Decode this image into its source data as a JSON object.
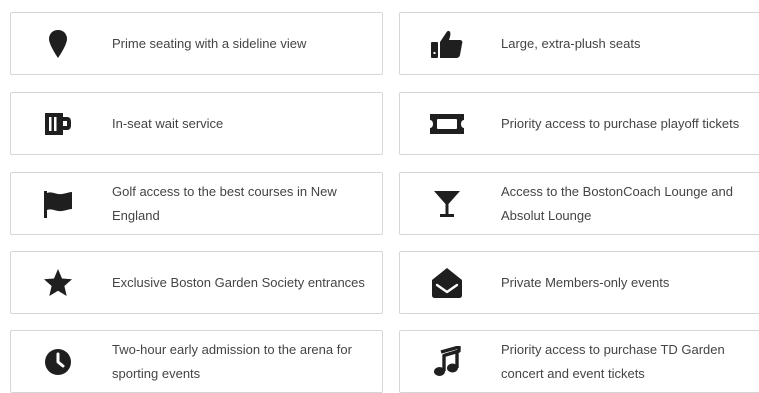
{
  "colors": {
    "icon": "#1f1f1f",
    "text": "#444444",
    "border": "#d6d6d6"
  },
  "benefits": [
    {
      "icon": "map-pin-icon",
      "text": "Prime seating with a sideline view"
    },
    {
      "icon": "thumbs-up-icon",
      "text": "Large, extra-plush seats"
    },
    {
      "icon": "beer-mug-icon",
      "text": "In-seat wait service"
    },
    {
      "icon": "ticket-icon",
      "text": "Priority access to purchase playoff tickets"
    },
    {
      "icon": "flag-icon",
      "text": "Golf access to the best courses in New England"
    },
    {
      "icon": "cocktail-glass-icon",
      "text": "Access to the BostonCoach Lounge and Absolut Lounge"
    },
    {
      "icon": "star-icon",
      "text": "Exclusive Boston Garden Society entrances"
    },
    {
      "icon": "envelope-open-icon",
      "text": "Private Members-only events"
    },
    {
      "icon": "clock-icon",
      "text": "Two-hour early admission to the arena for sporting events"
    },
    {
      "icon": "music-note-icon",
      "text": "Priority access to purchase TD Garden concert and event tickets"
    }
  ]
}
